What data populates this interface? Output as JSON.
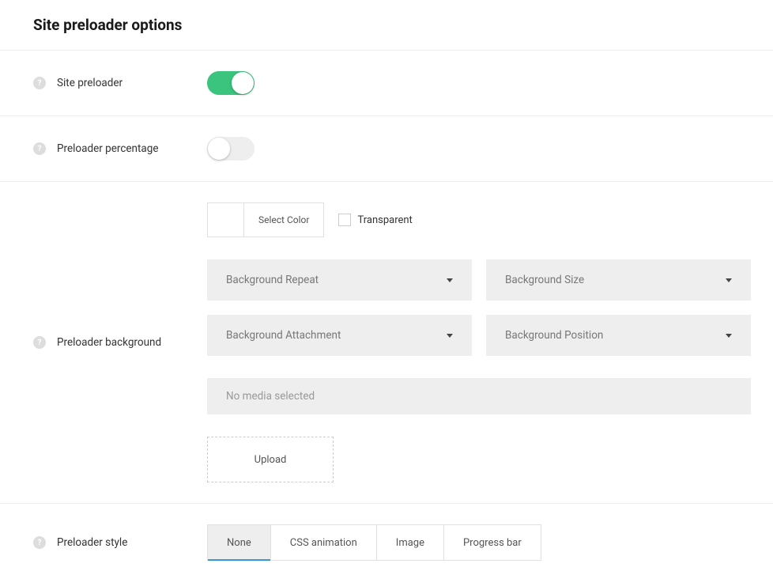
{
  "title": "Site preloader options",
  "rows": {
    "preloader": {
      "label": "Site preloader",
      "value": true
    },
    "percentage": {
      "label": "Preloader percentage",
      "value": false
    },
    "background": {
      "label": "Preloader background",
      "color": {
        "select_label": "Select Color",
        "transparent_label": "Transparent",
        "transparent": false
      },
      "dropdowns": {
        "repeat": "Background Repeat",
        "size": "Background Size",
        "attachment": "Background Attachment",
        "position": "Background Position"
      },
      "media": {
        "placeholder": "No media selected",
        "upload_label": "Upload"
      }
    },
    "style": {
      "label": "Preloader style",
      "tabs": [
        "None",
        "CSS animation",
        "Image",
        "Progress bar"
      ],
      "active": 0
    }
  }
}
